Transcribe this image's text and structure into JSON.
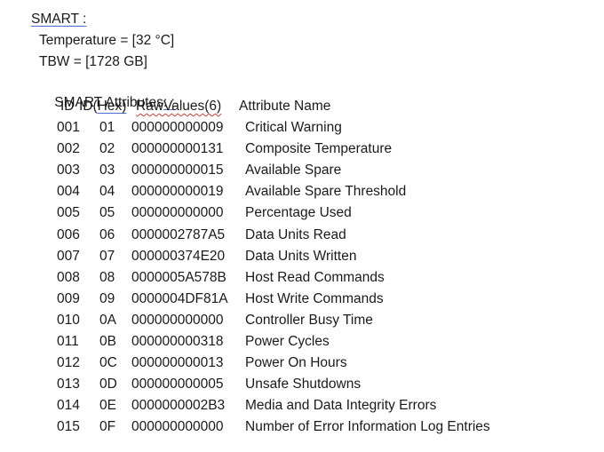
{
  "title": "SMART :",
  "temperature": "Temperature = [32 °C]",
  "tbw": "TBW = [1728 GB]",
  "attributes_label_main": "SMART Attributes",
  "attributes_label_suffix": ": :",
  "table": {
    "headers": {
      "id": "ID",
      "id_hex_prefix": "ID(",
      "id_hex_word": "Hex)",
      "raw_values": "RawValues(6)",
      "name": "Attribute Name"
    },
    "rows": [
      {
        "id": "001",
        "hex": "01",
        "raw": "000000000009",
        "name": "Critical Warning"
      },
      {
        "id": "002",
        "hex": "02",
        "raw": "000000000131",
        "name": "Composite Temperature"
      },
      {
        "id": "003",
        "hex": "03",
        "raw": "000000000015",
        "name": "Available Spare"
      },
      {
        "id": "004",
        "hex": "04",
        "raw": "000000000019",
        "name": "Available Spare Threshold"
      },
      {
        "id": "005",
        "hex": "05",
        "raw": "000000000000",
        "name": "Percentage Used"
      },
      {
        "id": "006",
        "hex": "06",
        "raw": "0000002787A5",
        "name": "Data Units Read"
      },
      {
        "id": "007",
        "hex": "07",
        "raw": "000000374E20",
        "name": "Data Units Written"
      },
      {
        "id": "008",
        "hex": "08",
        "raw": "0000005A578B",
        "name": "Host Read Commands"
      },
      {
        "id": "009",
        "hex": "09",
        "raw": "0000004DF81A",
        "name": "Host Write Commands"
      },
      {
        "id": "010",
        "hex": "0A",
        "raw": "000000000000",
        "name": "Controller Busy Time"
      },
      {
        "id": "011",
        "hex": "0B",
        "raw": "000000000318",
        "name": "Power Cycles"
      },
      {
        "id": "012",
        "hex": "0C",
        "raw": "000000000013",
        "name": "Power On Hours"
      },
      {
        "id": "013",
        "hex": "0D",
        "raw": "000000000005",
        "name": "Unsafe Shutdowns"
      },
      {
        "id": "014",
        "hex": "0E",
        "raw": "0000000002B3",
        "name": "Media and Data Integrity Errors"
      },
      {
        "id": "015",
        "hex": "0F",
        "raw": "000000000000",
        "name": "Number of Error Information Log Entries"
      }
    ]
  }
}
